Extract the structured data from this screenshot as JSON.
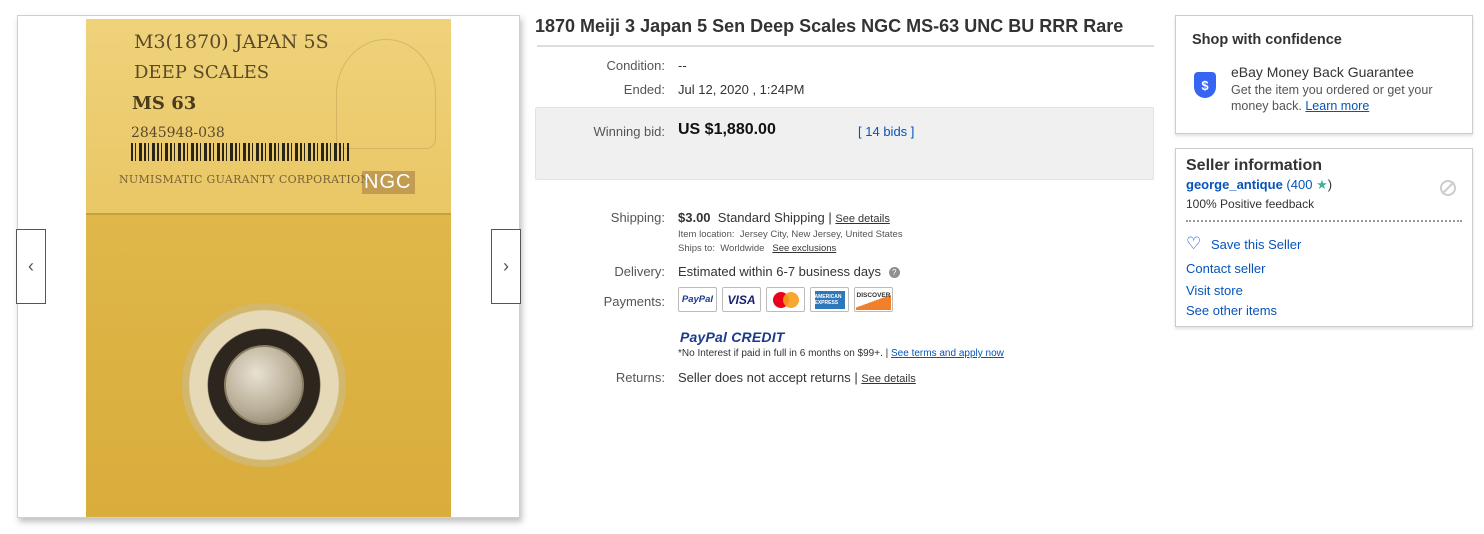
{
  "listing": {
    "title": "1870 Meiji 3 Japan 5 Sen Deep Scales NGC MS-63 UNC BU RRR Rare",
    "condition_label": "Condition:",
    "condition_value": "--",
    "ended_label": "Ended:",
    "ended_value": "Jul 12, 2020 , 1:24PM",
    "winning_bid_label": "Winning bid:",
    "winning_bid_value": "US $1,880.00",
    "bids_open": "[",
    "bids_link": "14 bids",
    "bids_close": "]"
  },
  "image": {
    "label_line1": "M3(1870) JAPAN 5S",
    "label_line2": "DEEP SCALES",
    "label_line3": "MS 63",
    "label_line4": "2845948-038",
    "label_line5": "NUMISMATIC GUARANTY CORPORATION",
    "label_line6": "NGC",
    "prev_arrow": "‹",
    "next_arrow": "›"
  },
  "shipping": {
    "label": "Shipping:",
    "cost": "$3.00",
    "method": "Standard Shipping",
    "sep": "|",
    "details_link": "See details",
    "location_label": "Item location:",
    "location_value": "Jersey City, New Jersey, United States",
    "ships_to_label": "Ships to:",
    "ships_to_value": "Worldwide",
    "exclusions_link": "See exclusions"
  },
  "delivery": {
    "label": "Delivery:",
    "value": "Estimated within 6-7 business days",
    "help": "?"
  },
  "payments": {
    "label": "Payments:",
    "logos": {
      "paypal": "PayPal",
      "visa": "VISA",
      "amex": "AMERICAN EXPRESS",
      "discover": "DISCOVER"
    },
    "credit_brand_a": "PayPal",
    "credit_brand_b": "CREDIT",
    "credit_note": "*No Interest if paid in full in 6 months on $99+.",
    "credit_sep": "|",
    "credit_link": "See terms and apply now"
  },
  "returns": {
    "label": "Returns:",
    "value": "Seller does not accept returns",
    "sep": "|",
    "link": "See details"
  },
  "confidence": {
    "heading": "Shop with confidence",
    "shield": "$",
    "mbg_title": "eBay Money Back Guarantee",
    "mbg_text": "Get the item you ordered or get your money back.",
    "learn_more": "Learn more"
  },
  "seller": {
    "heading": "Seller information",
    "name": "george_antique",
    "feedback_open": "(",
    "feedback_score": "400",
    "star": "★",
    "feedback_close": ")",
    "positive": "100% Positive feedback",
    "save": "Save this Seller",
    "contact": "Contact seller",
    "visit": "Visit store",
    "other": "See other items"
  },
  "colors": {
    "link": "#0654ba",
    "shield": "#3665f3",
    "bid_box": "#f0f0f0"
  }
}
